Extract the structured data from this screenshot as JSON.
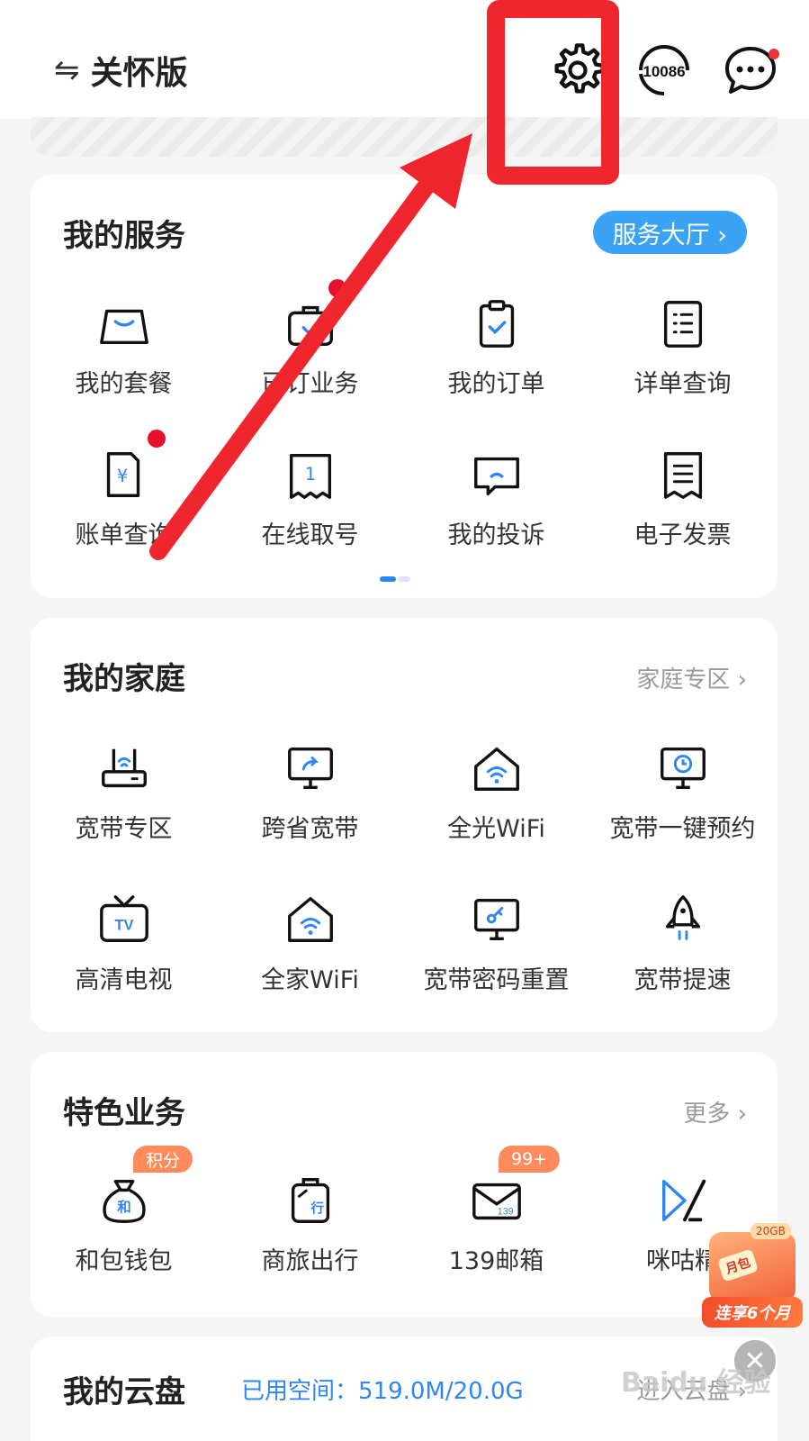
{
  "header": {
    "care_mode_label": "关怀版",
    "swap_glyph": "⇋",
    "settings_icon": "gear-icon",
    "hotline_text": "10086",
    "message_icon": "chat-bubble-icon"
  },
  "services": {
    "title": "我的服务",
    "hall_button": "服务大厅 ›",
    "items": [
      {
        "label": "我的套餐",
        "icon": "shopping-bag-icon"
      },
      {
        "label": "已订业务",
        "icon": "briefcase-check-icon"
      },
      {
        "label": "我的订单",
        "icon": "clipboard-check-icon"
      },
      {
        "label": "详单查询",
        "icon": "list-document-icon"
      },
      {
        "label": "账单查询",
        "icon": "yuan-bill-icon"
      },
      {
        "label": "在线取号",
        "icon": "queue-ticket-icon"
      },
      {
        "label": "我的投诉",
        "icon": "complaint-chat-icon"
      },
      {
        "label": "电子发票",
        "icon": "invoice-icon"
      }
    ]
  },
  "family": {
    "title": "我的家庭",
    "more": "家庭专区 ›",
    "items": [
      {
        "label": "宽带专区",
        "icon": "router-icon"
      },
      {
        "label": "跨省宽带",
        "icon": "monitor-share-icon"
      },
      {
        "label": "全光WiFi",
        "icon": "home-wifi-icon"
      },
      {
        "label": "宽带一键预约",
        "icon": "monitor-clock-icon"
      },
      {
        "label": "高清电视",
        "icon": "tv-icon"
      },
      {
        "label": "全家WiFi",
        "icon": "house-wifi-icon"
      },
      {
        "label": "宽带密码重置",
        "icon": "monitor-key-icon"
      },
      {
        "label": "宽带提速",
        "icon": "rocket-icon"
      }
    ]
  },
  "featured": {
    "title": "特色业务",
    "more": "更多 ›",
    "items": [
      {
        "label": "和包钱包",
        "icon": "money-bag-icon",
        "badge": "积分"
      },
      {
        "label": "商旅出行",
        "icon": "luggage-icon"
      },
      {
        "label": "139邮箱",
        "icon": "mail-icon",
        "badge": "99+"
      },
      {
        "label": "咪咕精",
        "icon": "migu-play-icon"
      }
    ],
    "bag_glyph": "和",
    "luggage_glyph": "行",
    "mail_glyph": "139",
    "tv_glyph": "TV"
  },
  "cloud": {
    "title": "我的云盘",
    "used": "已用空间：519.0M/20.0G",
    "enter": "进入云盘 ›"
  },
  "promo": {
    "top_tag": "20GB",
    "card_text": "月包",
    "ribbon": "连享6个月"
  },
  "watermark": "Baidu 经验",
  "colors": {
    "accent_blue": "#3aa3f5",
    "link_blue": "#2f86f0",
    "annotation_red": "#f0262e",
    "dot_red": "#e8112d"
  }
}
